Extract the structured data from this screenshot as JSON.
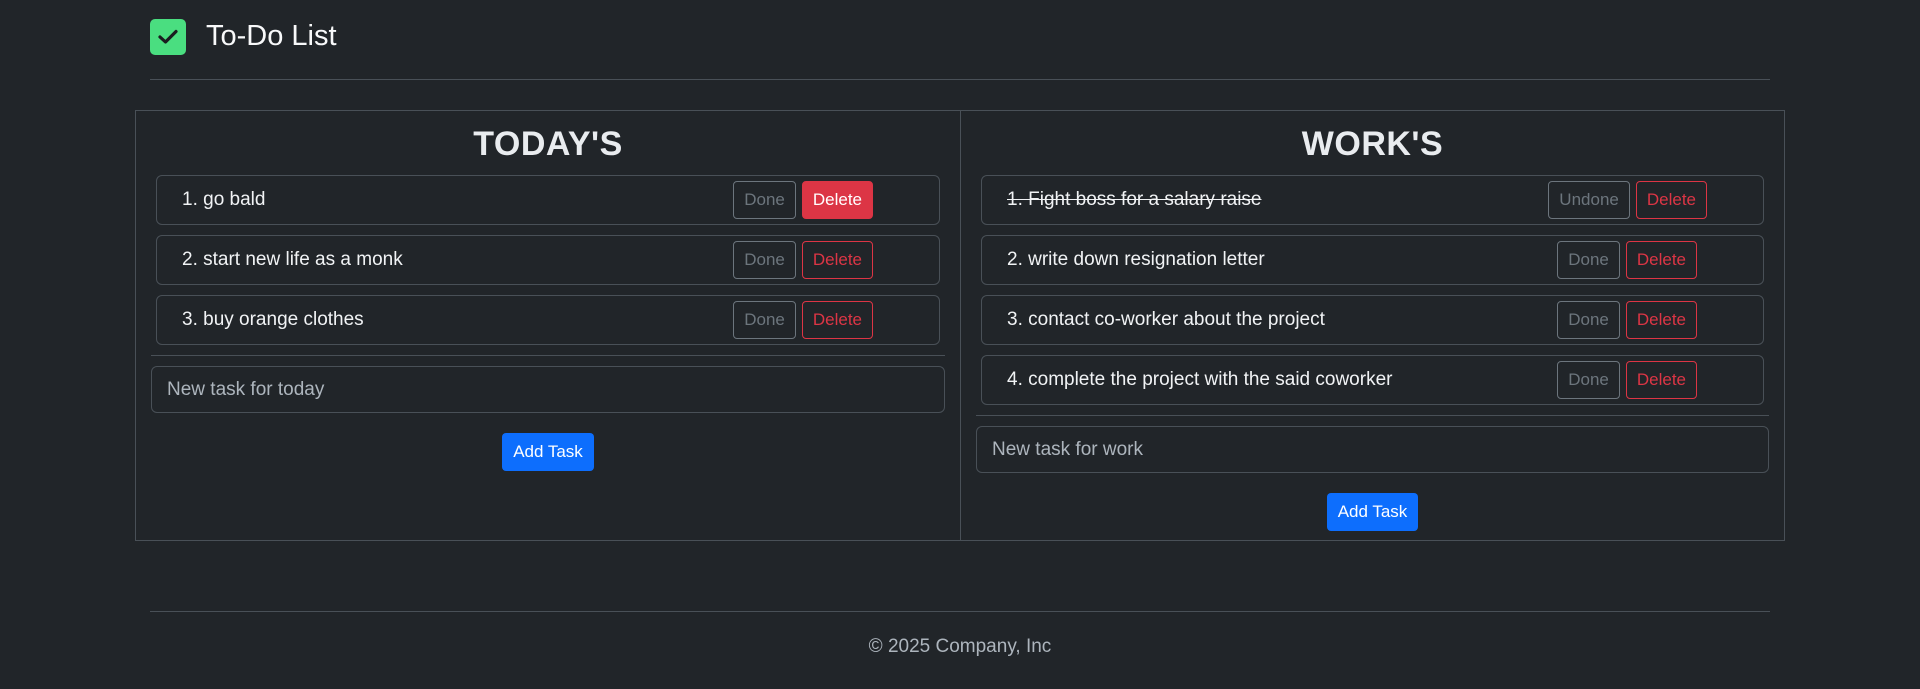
{
  "header": {
    "title": "To-Do List",
    "logo_icon": "checkbox-icon",
    "logo_color": "#4ade80"
  },
  "today": {
    "title": "TODAY'S",
    "tasks": [
      {
        "text": "1. go bald",
        "done": false,
        "action": "Done",
        "delete": "Delete"
      },
      {
        "text": "2. start new life as a monk",
        "done": false,
        "action": "Done",
        "delete": "Delete"
      },
      {
        "text": "3. buy orange clothes",
        "done": false,
        "action": "Done",
        "delete": "Delete"
      }
    ],
    "input_placeholder": "New task for today",
    "input_value": "",
    "add_label": "Add Task"
  },
  "work": {
    "title": "WORK'S",
    "tasks": [
      {
        "text": "1. Fight boss for a salary raise",
        "done": true,
        "action": "Undone",
        "delete": "Delete"
      },
      {
        "text": "2. write down resignation letter",
        "done": false,
        "action": "Done",
        "delete": "Delete"
      },
      {
        "text": "3. contact co-worker about the project",
        "done": false,
        "action": "Done",
        "delete": "Delete"
      },
      {
        "text": "4. complete the project with the said coworker",
        "done": false,
        "action": "Done",
        "delete": "Delete"
      }
    ],
    "input_placeholder": "New task for work",
    "input_value": "",
    "add_label": "Add Task"
  },
  "footer": {
    "copyright": "© 2025 Company, Inc"
  },
  "colors": {
    "background": "#212529",
    "primary": "#0d6efd",
    "danger": "#dc3545",
    "secondary": "#6c757d"
  }
}
